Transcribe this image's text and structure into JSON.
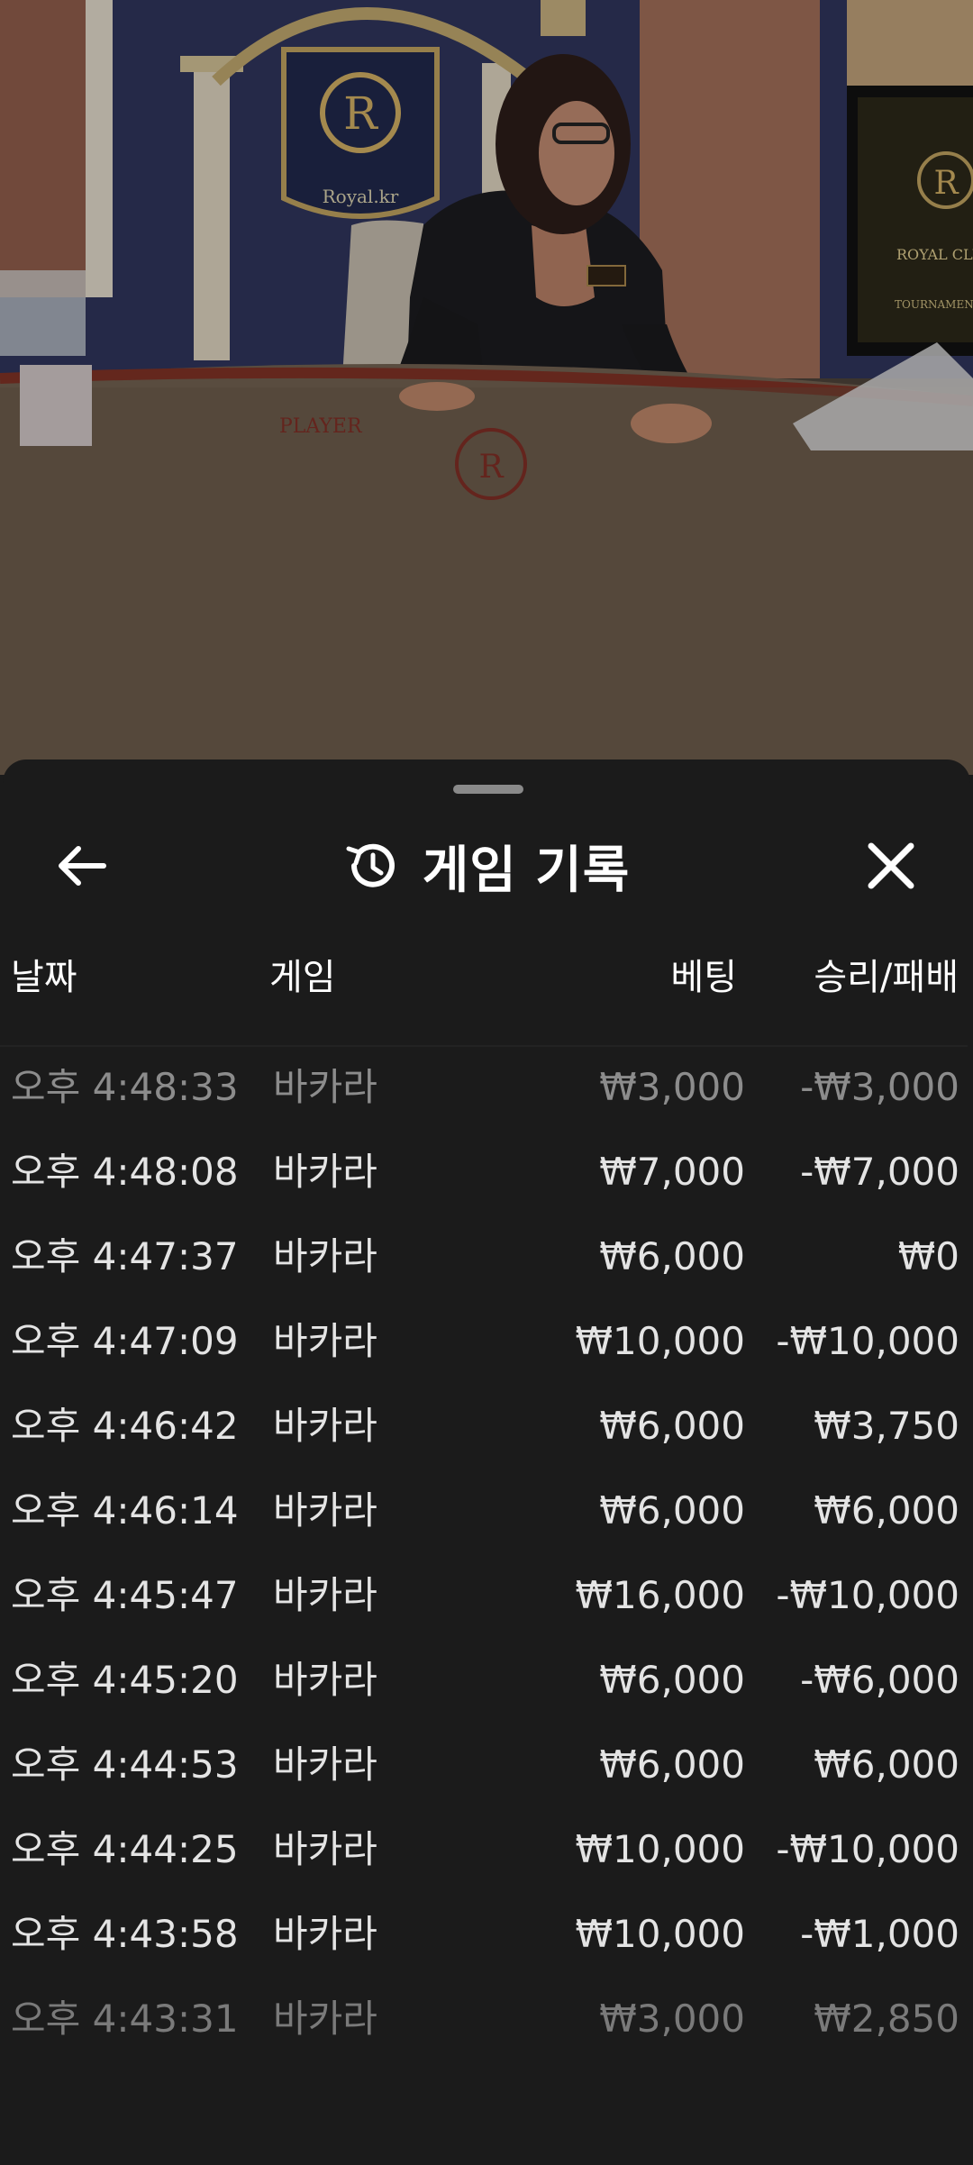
{
  "video": {
    "logo_text": "Royal.kr",
    "table_label": "PLAYER",
    "monitor_text": "ROYAL CLUB",
    "monitor_sub": "TOURNAMENT"
  },
  "sheet": {
    "title": "게임 기록",
    "columns": {
      "date": "날짜",
      "game": "게임",
      "bet": "베팅",
      "win_loss": "승리/패배"
    },
    "rows": [
      {
        "date": "오후 4:48:33",
        "game": "바카라",
        "bet": "₩3,000",
        "result": "-₩3,000"
      },
      {
        "date": "오후 4:48:08",
        "game": "바카라",
        "bet": "₩7,000",
        "result": "-₩7,000"
      },
      {
        "date": "오후 4:47:37",
        "game": "바카라",
        "bet": "₩6,000",
        "result": "₩0"
      },
      {
        "date": "오후 4:47:09",
        "game": "바카라",
        "bet": "₩10,000",
        "result": "-₩10,000"
      },
      {
        "date": "오후 4:46:42",
        "game": "바카라",
        "bet": "₩6,000",
        "result": "₩3,750"
      },
      {
        "date": "오후 4:46:14",
        "game": "바카라",
        "bet": "₩6,000",
        "result": "₩6,000"
      },
      {
        "date": "오후 4:45:47",
        "game": "바카라",
        "bet": "₩16,000",
        "result": "-₩10,000"
      },
      {
        "date": "오후 4:45:20",
        "game": "바카라",
        "bet": "₩6,000",
        "result": "-₩6,000"
      },
      {
        "date": "오후 4:44:53",
        "game": "바카라",
        "bet": "₩6,000",
        "result": "₩6,000"
      },
      {
        "date": "오후 4:44:25",
        "game": "바카라",
        "bet": "₩10,000",
        "result": "-₩10,000"
      },
      {
        "date": "오후 4:43:58",
        "game": "바카라",
        "bet": "₩10,000",
        "result": "-₩1,000"
      },
      {
        "date": "오후 4:43:31",
        "game": "바카라",
        "bet": "₩3,000",
        "result": "₩2,850"
      }
    ]
  }
}
